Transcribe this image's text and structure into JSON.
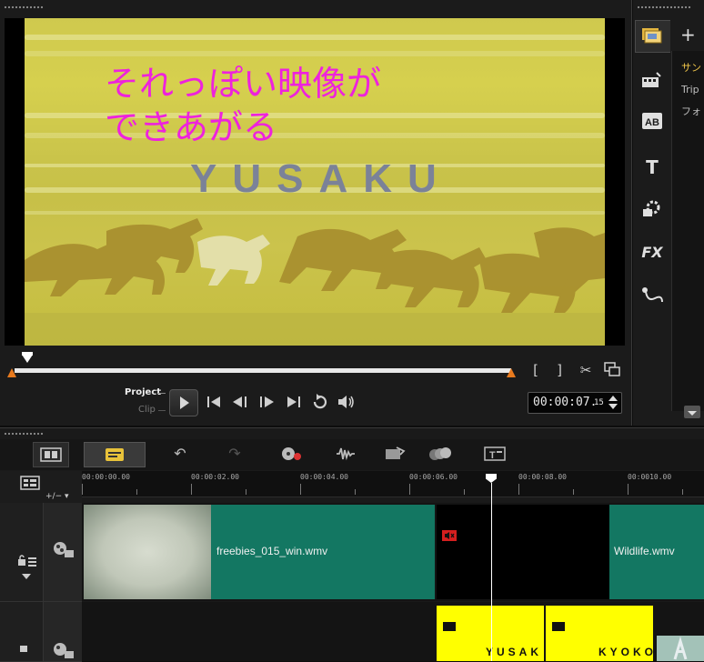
{
  "preview": {
    "caption_text": "それっぽい映像が\nできあがる",
    "title_overlay": "YUSAKU",
    "mode_project": "Project",
    "mode_clip": "Clip",
    "mark_in": "[",
    "mark_out": "]",
    "timecode_main": "00:00:07.",
    "timecode_frame": "15"
  },
  "library": {
    "items": [
      "サン",
      "Trip",
      "フォ"
    ]
  },
  "timeline": {
    "ruler_ticks": [
      "00:00:00.00",
      "00:00:02.00",
      "00:00:04.00",
      "00:00:06.00",
      "00:00:08.00",
      "00:0010.00"
    ],
    "video_track": {
      "clips": [
        {
          "name": "freebies_015_win.wmv"
        },
        {
          "name": "Wildlife.wmv"
        }
      ]
    },
    "overlay_track": {
      "clips": [
        {
          "name": "YUSAK"
        },
        {
          "name": "KYOKO"
        }
      ]
    }
  },
  "colors": {
    "accent_caption": "#ee22dd",
    "clip_teal": "#137762",
    "title_clip_yellow": "#ffff00",
    "playhead": "#ffffff"
  }
}
